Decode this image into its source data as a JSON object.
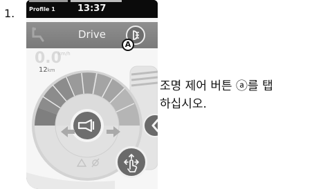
{
  "step": {
    "number": "1."
  },
  "status_bar": {
    "profile": "Profile 1",
    "time": "13:37"
  },
  "drive_bar": {
    "title": "Drive",
    "callout_marker": "A"
  },
  "speed": {
    "value": "0.0",
    "unit": "km/h"
  },
  "distance": {
    "value": "12",
    "unit": "km"
  },
  "instruction": {
    "line1": "조명 제어 버튼 ⓐ를 탭",
    "line2": "하십시오."
  },
  "icons": [
    "seat-icon",
    "light-icon",
    "horn-icon",
    "left-arrow-icon",
    "right-arrow-icon",
    "warning-icon",
    "lights-off-icon",
    "collapse-chevron-icon",
    "touch-joystick-icon"
  ],
  "colors": {
    "screen_bg": "#f6f6f6",
    "bezel": "#0b0b0b",
    "drive_bar": "#838383",
    "dial_active": "#8f8f8f",
    "dial_inactive": "#c4c4c4"
  }
}
